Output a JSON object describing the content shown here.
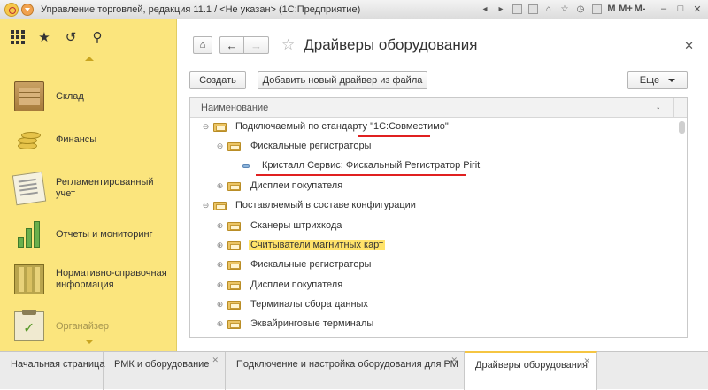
{
  "window": {
    "title": "Управление торговлей, редакция 11.1 / <Не указан>  (1С:Предприятие)",
    "toolbar_letters": [
      "M",
      "M+",
      "M-"
    ]
  },
  "sidebar": {
    "items": [
      {
        "label": "Склад"
      },
      {
        "label": "Финансы"
      },
      {
        "label": "Регламентированный учет"
      },
      {
        "label": "Отчеты и мониторинг"
      },
      {
        "label": "Нормативно-справочная информация"
      },
      {
        "label": "Органайзер"
      }
    ]
  },
  "main": {
    "title": "Драйверы оборудования",
    "buttons": {
      "create": "Создать",
      "add_from_file": "Добавить новый драйвер из файла",
      "more": "Еще"
    },
    "table": {
      "column": "Наименование",
      "rows": [
        {
          "label": "Подключаемый по стандарту \"1С:Совместимо\""
        },
        {
          "label": "Фискальные регистраторы"
        },
        {
          "label": "Кристалл Сервис: Фискальный Регистратор Pirit"
        },
        {
          "label": "Дисплеи покупателя"
        },
        {
          "label": "Поставляемый в составе конфигурации"
        },
        {
          "label": "Сканеры штрихкода"
        },
        {
          "label": "Считыватели магнитных карт"
        },
        {
          "label": "Фискальные регистраторы"
        },
        {
          "label": "Дисплеи покупателя"
        },
        {
          "label": "Терминалы сбора данных"
        },
        {
          "label": "Эквайринговые терминалы"
        }
      ]
    }
  },
  "tabs": [
    {
      "label": "Начальная страница"
    },
    {
      "label": "РМК и оборудование"
    },
    {
      "label": "Подключение и настройка оборудования для РМ"
    },
    {
      "label": "Драйверы оборудования"
    }
  ],
  "colors": {
    "sidebar_bg": "#fbe57d",
    "highlight": "#ffe36a",
    "annotation_underline": "#e02020",
    "active_tab_accent": "#f5c542"
  }
}
